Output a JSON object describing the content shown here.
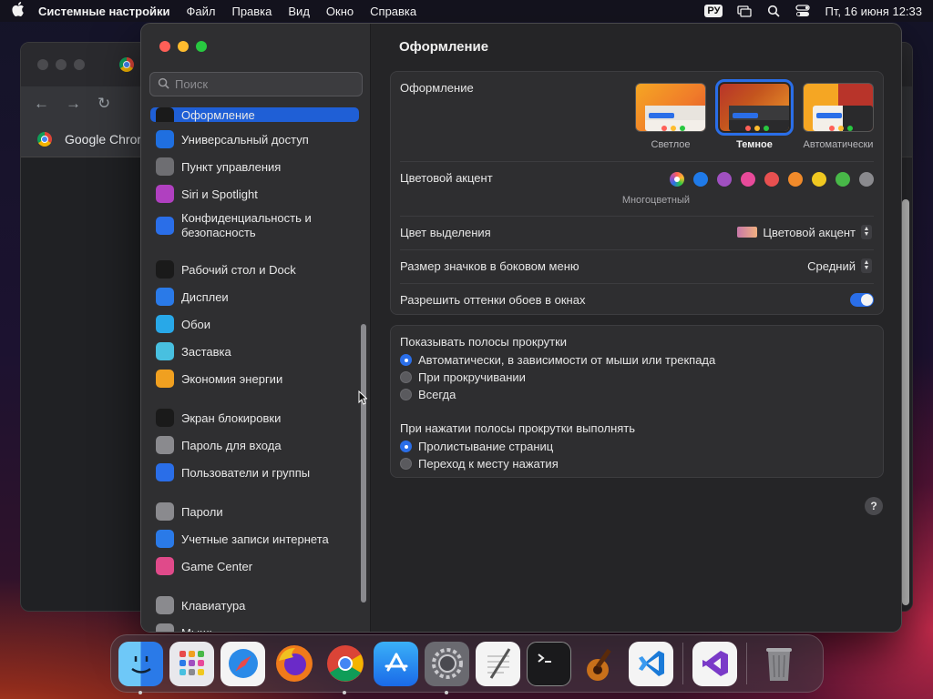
{
  "menubar": {
    "app_name": "Системные настройки",
    "menus": [
      "Файл",
      "Правка",
      "Вид",
      "Окно",
      "Справка"
    ],
    "input_source": "РУ",
    "clock": "Пт, 16 июня  12:33"
  },
  "chrome": {
    "bookmark_label": "Google Chrom"
  },
  "settings": {
    "search_placeholder": "Поиск",
    "sidebar": [
      {
        "label": "Оформление",
        "icon": "appearance-icon",
        "color": "#1a1a1a",
        "active": true
      },
      {
        "label": "Универсальный доступ",
        "icon": "accessibility-icon",
        "color": "#1f6fe0"
      },
      {
        "label": "Пункт управления",
        "icon": "control-center-icon",
        "color": "#6e6e72"
      },
      {
        "label": "Siri и Spotlight",
        "icon": "siri-icon",
        "color": "#b040c0"
      },
      {
        "label": "Конфиденциальность и безопасность",
        "icon": "privacy-hand-icon",
        "color": "#2a6ee8"
      },
      {
        "label": "Рабочий стол и Dock",
        "icon": "desktop-dock-icon",
        "color": "#1a1a1a"
      },
      {
        "label": "Дисплеи",
        "icon": "displays-icon",
        "color": "#2a7ae8"
      },
      {
        "label": "Обои",
        "icon": "wallpaper-icon",
        "color": "#28a8e8"
      },
      {
        "label": "Заставка",
        "icon": "screensaver-icon",
        "color": "#48c0e0"
      },
      {
        "label": "Экономия энергии",
        "icon": "battery-bulb-icon",
        "color": "#f0a020"
      },
      {
        "label": "Экран блокировки",
        "icon": "lock-screen-icon",
        "color": "#1a1a1a"
      },
      {
        "label": "Пароль для входа",
        "icon": "password-lock-icon",
        "color": "#8a8a8e"
      },
      {
        "label": "Пользователи и группы",
        "icon": "users-groups-icon",
        "color": "#2a6ee8"
      },
      {
        "label": "Пароли",
        "icon": "key-icon",
        "color": "#8a8a8e"
      },
      {
        "label": "Учетные записи интернета",
        "icon": "at-sign-icon",
        "color": "#2a7ae8"
      },
      {
        "label": "Game Center",
        "icon": "game-center-icon",
        "color": "#e04a8a"
      },
      {
        "label": "Клавиатура",
        "icon": "keyboard-icon",
        "color": "#8a8a8e"
      },
      {
        "label": "Мышь",
        "icon": "mouse-icon",
        "color": "#8a8a8e"
      }
    ],
    "title": "Оформление",
    "appearance": {
      "label": "Оформление",
      "options": [
        {
          "caption": "Светлое",
          "selected": false
        },
        {
          "caption": "Темное",
          "selected": true
        },
        {
          "caption": "Автоматически",
          "selected": false
        }
      ]
    },
    "accent": {
      "label": "Цветовой акцент",
      "caption": "Многоцветный",
      "colors": [
        "multicolor",
        "#1f7ae8",
        "#a050c0",
        "#e84a9a",
        "#e85050",
        "#f08a2a",
        "#f0c820",
        "#48b848",
        "#8a8a8e"
      ]
    },
    "highlight": {
      "label": "Цвет выделения",
      "value": "Цветовой акцент"
    },
    "sidebar_icon_size": {
      "label": "Размер значков в боковом меню",
      "value": "Средний"
    },
    "wallpaper_tinting": {
      "label": "Разрешить оттенки обоев в окнах",
      "enabled": true
    },
    "scrollbars": {
      "label": "Показывать полосы прокрутки",
      "options": [
        {
          "label": "Автоматически, в зависимости от мыши или трекпада",
          "selected": true
        },
        {
          "label": "При прокручивании",
          "selected": false
        },
        {
          "label": "Всегда",
          "selected": false
        }
      ]
    },
    "click_scrollbar": {
      "label": "При нажатии полосы прокрутки выполнять",
      "options": [
        {
          "label": "Пролистывание страниц",
          "selected": true
        },
        {
          "label": "Переход к месту нажатия",
          "selected": false
        }
      ]
    },
    "help_label": "?"
  },
  "dock": {
    "apps": [
      "Finder",
      "Launchpad",
      "Safari",
      "Firefox",
      "Google Chrome",
      "App Store",
      "Системные настройки",
      "TextEdit",
      "Терминал",
      "GarageBand",
      "Visual Studio Code",
      "Visual Studio",
      "Корзина"
    ]
  }
}
